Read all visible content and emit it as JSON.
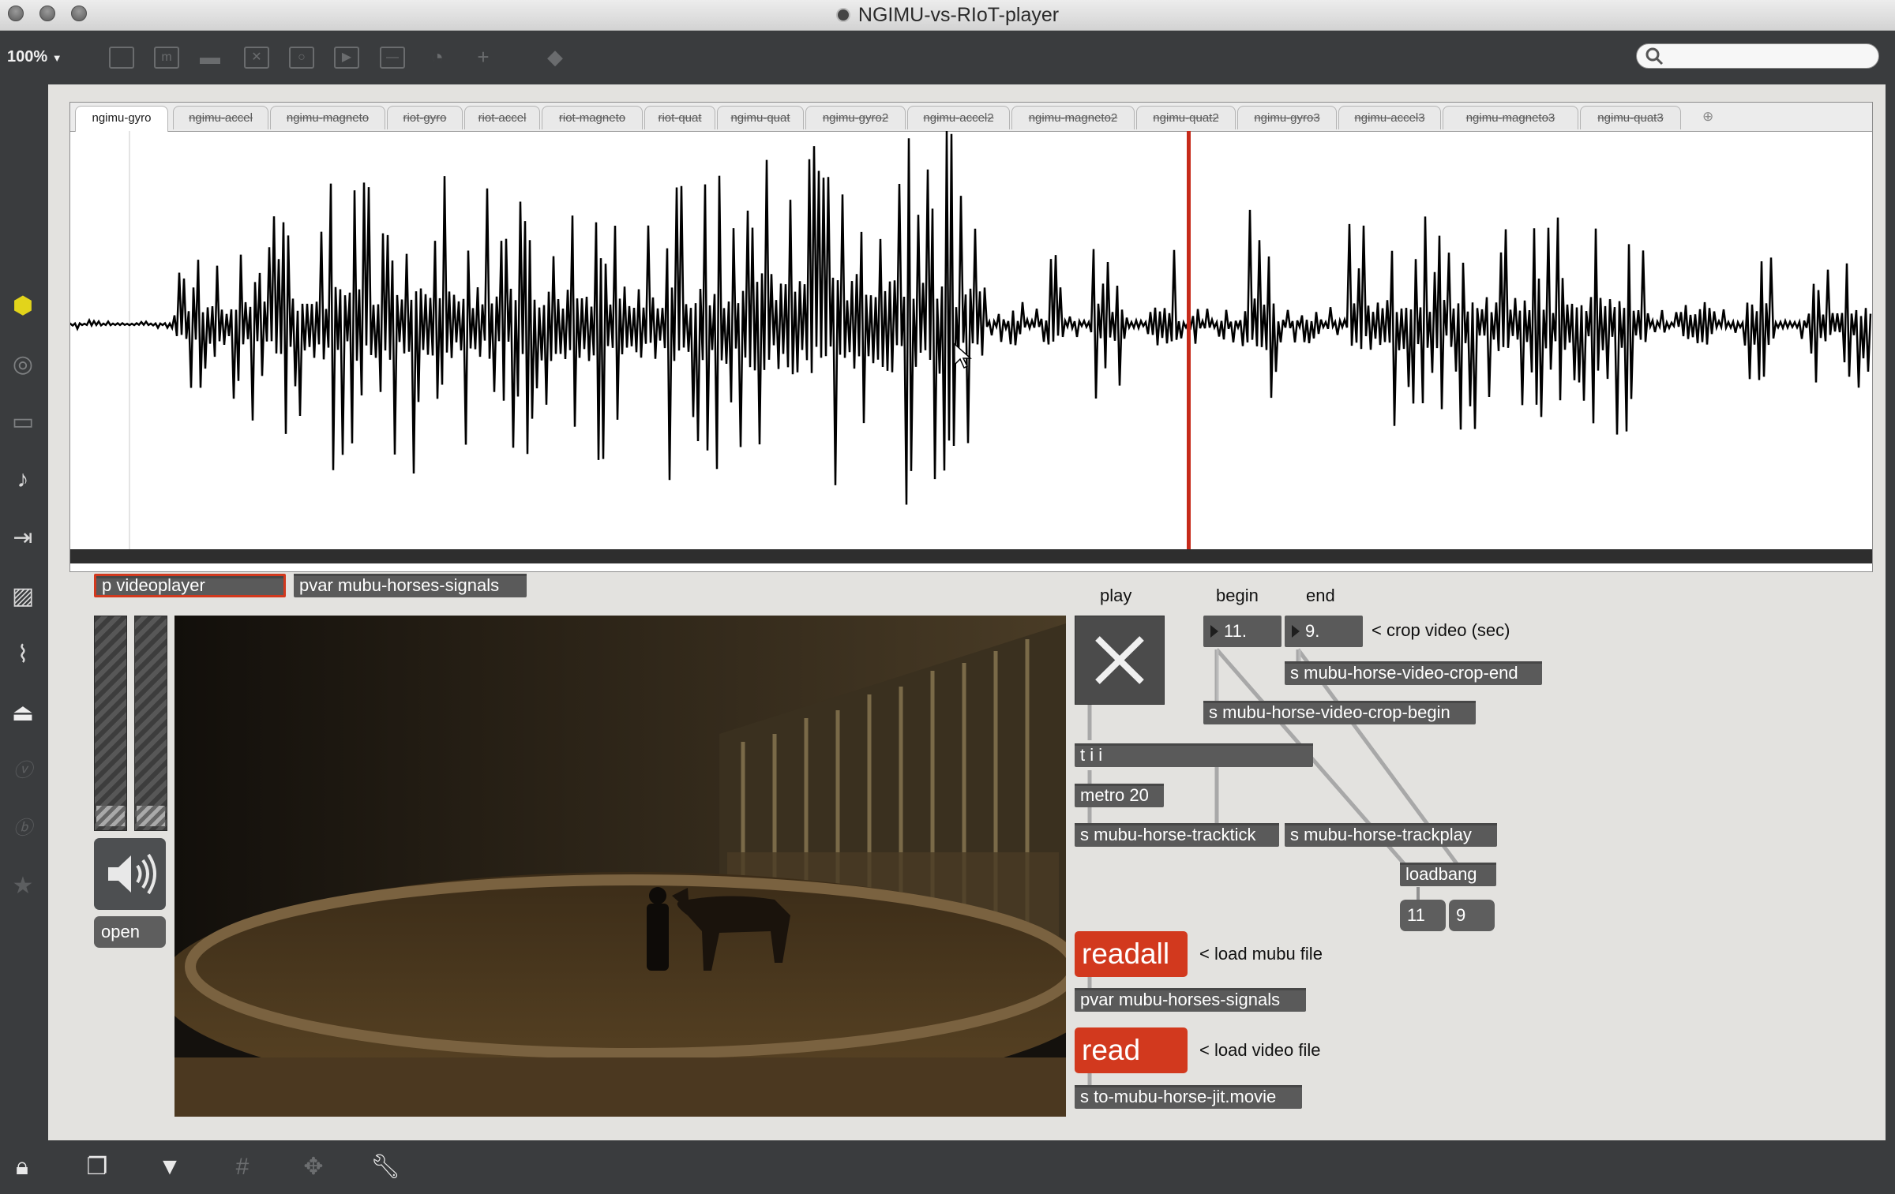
{
  "window": {
    "title": "NGIMU-vs-RIoT-player"
  },
  "toolbar": {
    "zoom": "100%",
    "icons": [
      "presentation-icon",
      "patcher-icon",
      "comment-icon",
      "button-icon",
      "toggle-icon",
      "object-icon",
      "slider-icon",
      "dial-icon",
      "add-icon",
      "paint-bucket-icon"
    ],
    "search_placeholder": ""
  },
  "left_sidebar": {
    "icons": [
      "package-icon",
      "target-icon",
      "keyboard-icon",
      "music-note-icon",
      "sequence-icon",
      "image-icon",
      "paperclip-icon",
      "plug-icon",
      "v-icon",
      "b-icon",
      "star-icon"
    ]
  },
  "bottom_bar": {
    "icons": [
      "lock-icon",
      "windows-icon",
      "presentation-icon",
      "grid-icon",
      "snap-icon",
      "wrench-icon"
    ]
  },
  "track_view": {
    "tabs": [
      {
        "label": "ngimu-gyro",
        "active": true
      },
      {
        "label": "ngimu-accel",
        "active": false
      },
      {
        "label": "ngimu-magneto",
        "active": false
      },
      {
        "label": "riot-gyro",
        "active": false
      },
      {
        "label": "riot-accel",
        "active": false
      },
      {
        "label": "riot-magneto",
        "active": false
      },
      {
        "label": "riot-quat",
        "active": false
      },
      {
        "label": "ngimu-quat",
        "active": false
      },
      {
        "label": "ngimu-gyro2",
        "active": false
      },
      {
        "label": "ngimu-accel2",
        "active": false
      },
      {
        "label": "ngimu-magneto2",
        "active": false
      },
      {
        "label": "ngimu-quat2",
        "active": false
      },
      {
        "label": "ngimu-gyro3",
        "active": false
      },
      {
        "label": "ngimu-accel3",
        "active": false
      },
      {
        "label": "ngimu-magneto3",
        "active": false
      },
      {
        "label": "ngimu-quat3",
        "active": false
      }
    ],
    "add_tab": "⊕",
    "playhead_color": "#c62a1a"
  },
  "patch": {
    "videoplayer": "p videoplayer",
    "pvar_top": "pvar mubu-horses-signals",
    "open": "open",
    "play_label": "play",
    "begin_label": "begin",
    "end_label": "end",
    "begin_value": "11.",
    "end_value": "9.",
    "crop_comment": "< crop video (sec)",
    "crop_end": "s mubu-horse-video-crop-end",
    "crop_begin": "s mubu-horse-video-crop-begin",
    "tii": "t i i",
    "metro": "metro 20",
    "tracktick": "s mubu-horse-tracktick",
    "trackplay": "s mubu-horse-trackplay",
    "loadbang": "loadbang",
    "msg11": "11",
    "msg9": "9",
    "readall": "readall",
    "load_mubu": "< load mubu file",
    "pvar_bottom": "pvar mubu-horses-signals",
    "read": "read",
    "load_video": "< load video file",
    "jit_movie": "s to-mubu-horse-jit.movie",
    "accent": "#d2391e"
  }
}
